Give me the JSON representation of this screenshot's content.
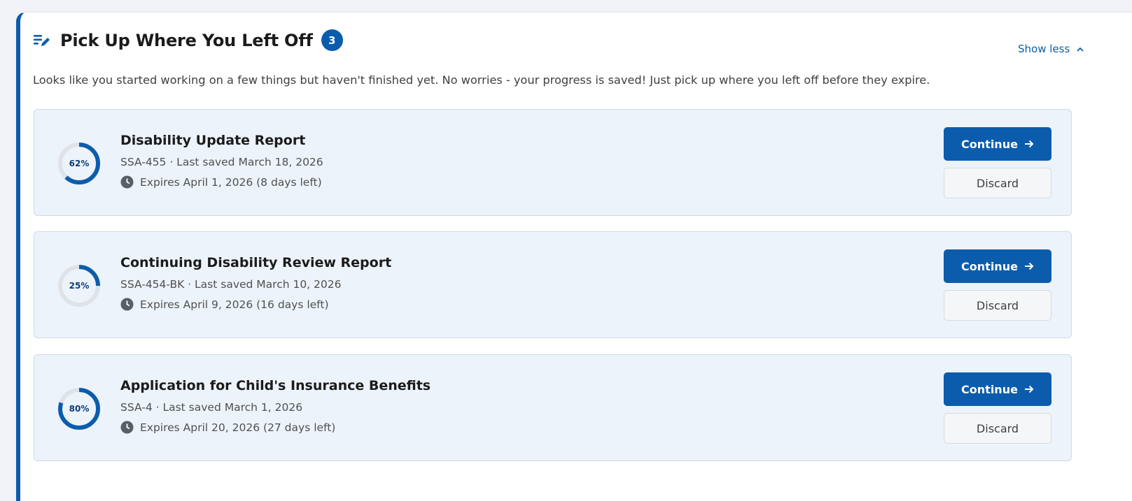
{
  "header": {
    "icon": "edit-list-icon",
    "title": "Pick Up Where You Left Off",
    "count": "3",
    "toggle_label": "Show less",
    "toggle_icon": "chevron-up-icon",
    "subtitle": "Looks like you started working on a few things but haven't finished yet. No worries - your progress is saved! Just pick up where you left off before they expire."
  },
  "colors": {
    "accent": "#0b5cad",
    "card_background": "#edf3fa",
    "progress_track": "#dfe3e8"
  },
  "items": [
    {
      "title": "Disability Update Report",
      "meta": "SSA-455 · Last saved March 18, 2026",
      "expiry": "Expires April 1, 2026 (8 days left)",
      "progress": 62,
      "progress_label": "62%",
      "continue_label": "Continue",
      "discard_label": "Discard"
    },
    {
      "title": "Continuing Disability Review Report",
      "meta": "SSA-454-BK · Last saved March 10, 2026",
      "expiry": "Expires April 9, 2026 (16 days left)",
      "progress": 25,
      "progress_label": "25%",
      "continue_label": "Continue",
      "discard_label": "Discard"
    },
    {
      "title": "Application for Child's Insurance Benefits",
      "meta": "SSA-4 · Last saved March 1, 2026",
      "expiry": "Expires April 20, 2026 (27 days left)",
      "progress": 80,
      "progress_label": "80%",
      "continue_label": "Continue",
      "discard_label": "Discard"
    }
  ]
}
